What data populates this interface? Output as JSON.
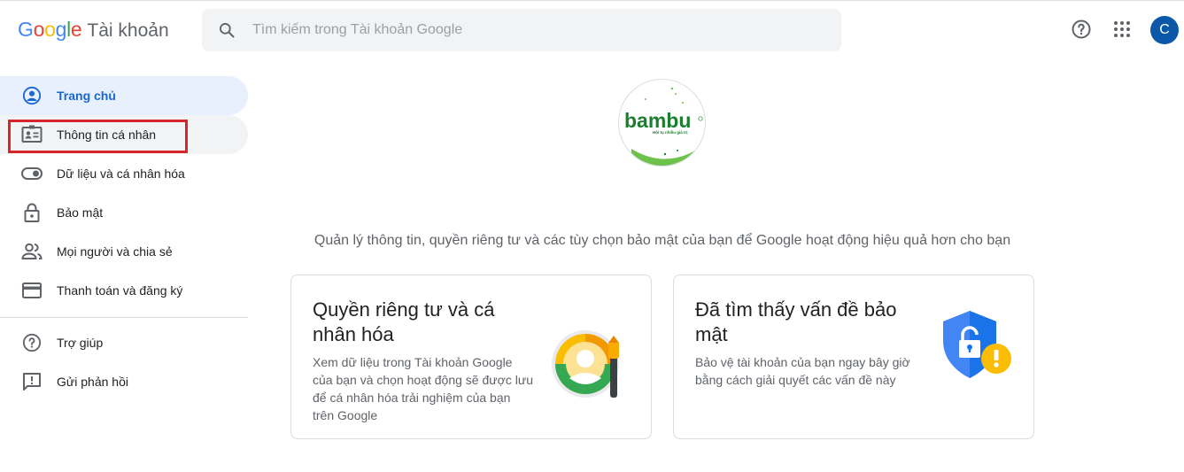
{
  "header": {
    "logo_google": "Google",
    "logo_product": "Tài khoản",
    "search_placeholder": "Tìm kiếm trong Tài khoản Google",
    "avatar_initial": "C"
  },
  "sidebar": {
    "items": [
      {
        "label": "Trang chủ",
        "icon": "account-circle-icon"
      },
      {
        "label": "Thông tin cá nhân",
        "icon": "id-card-icon"
      },
      {
        "label": "Dữ liệu và cá nhân hóa",
        "icon": "toggle-icon"
      },
      {
        "label": "Bảo mật",
        "icon": "lock-icon"
      },
      {
        "label": "Mọi người và chia sẻ",
        "icon": "people-icon"
      },
      {
        "label": "Thanh toán và đăng ký",
        "icon": "credit-card-icon"
      }
    ],
    "secondary": [
      {
        "label": "Trợ giúp",
        "icon": "help-icon"
      },
      {
        "label": "Gửi phản hồi",
        "icon": "feedback-icon"
      }
    ]
  },
  "profile": {
    "logo_text": "bambu",
    "logo_subtext": "Hội tụ nhiều giá trị",
    "brand_color": "#1a7f2e"
  },
  "main": {
    "tagline": "Quản lý thông tin, quyền riêng tư và các tùy chọn bảo mật của bạn để Google hoạt động hiệu quả hơn cho bạn",
    "cards": [
      {
        "title": "Quyền riêng tư và cá nhân hóa",
        "description": "Xem dữ liệu trong Tài khoản Google của bạn và chọn hoạt động sẽ được lưu để cá nhân hóa trải nghiệm của bạn trên Google",
        "illustration": "privacy-illustration-icon"
      },
      {
        "title": "Đã tìm thấy vấn đề bảo mật",
        "description": "Bảo vệ tài khoản của bạn ngay bây giờ bằng cách giải quyết các vấn đề này",
        "illustration": "security-shield-warning-icon"
      }
    ]
  },
  "colors": {
    "accent": "#1967d2",
    "active_bg": "#e8f0fe",
    "highlight": "#d7262b",
    "avatar_bg": "#0b57a8"
  }
}
